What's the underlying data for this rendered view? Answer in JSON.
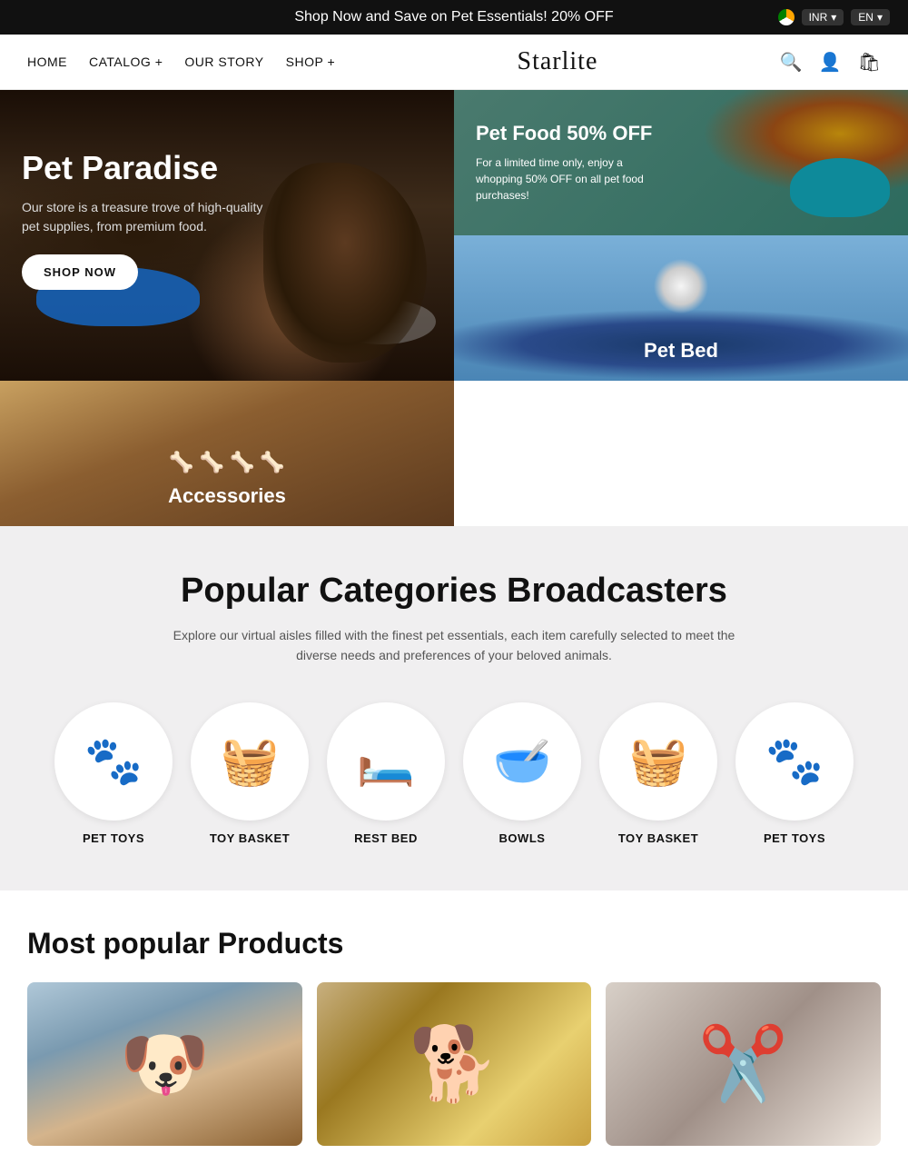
{
  "topBanner": {
    "text": "Shop Now and Save on Pet Essentials! 20% OFF",
    "currency": "INR",
    "language": "EN"
  },
  "nav": {
    "logo": "Starlite",
    "links": [
      {
        "label": "HOME",
        "href": "#"
      },
      {
        "label": "CATALOG +",
        "href": "#"
      },
      {
        "label": "OUR STORY",
        "href": "#"
      },
      {
        "label": "SHOP +",
        "href": "#"
      }
    ]
  },
  "hero": {
    "main": {
      "title": "Pet Paradise",
      "description": "Our store is a treasure trove of high-quality pet supplies, from premium food.",
      "buttonLabel": "SHOP NOW"
    },
    "topRight": {
      "title": "Pet Food 50% OFF",
      "description": "For a limited time only, enjoy a whopping 50% OFF on all pet food purchases!"
    },
    "bottomLeft": {
      "label": "Pet Bed"
    },
    "bottomRight": {
      "label": "Accessories"
    }
  },
  "categories": {
    "title": "Popular Categories Broadcasters",
    "description": "Explore our virtual aisles filled with the finest pet essentials, each item carefully selected to meet the diverse needs and preferences of your beloved animals.",
    "items": [
      {
        "label": "PET TOYS",
        "icon": "🐾"
      },
      {
        "label": "TOY BASKET",
        "icon": "🧺"
      },
      {
        "label": "REST BED",
        "icon": "🛏️"
      },
      {
        "label": "BOWLS",
        "icon": "🥣"
      },
      {
        "label": "TOY BASKET",
        "icon": "🧺"
      },
      {
        "label": "PET TOYS",
        "icon": "🐾"
      }
    ]
  },
  "popularProducts": {
    "title": "Most popular Products",
    "items": [
      {
        "label": "Dog Close-up",
        "type": "dog"
      },
      {
        "label": "Chihuahua",
        "type": "chihuahua"
      },
      {
        "label": "Grooming",
        "type": "grooming"
      }
    ]
  }
}
